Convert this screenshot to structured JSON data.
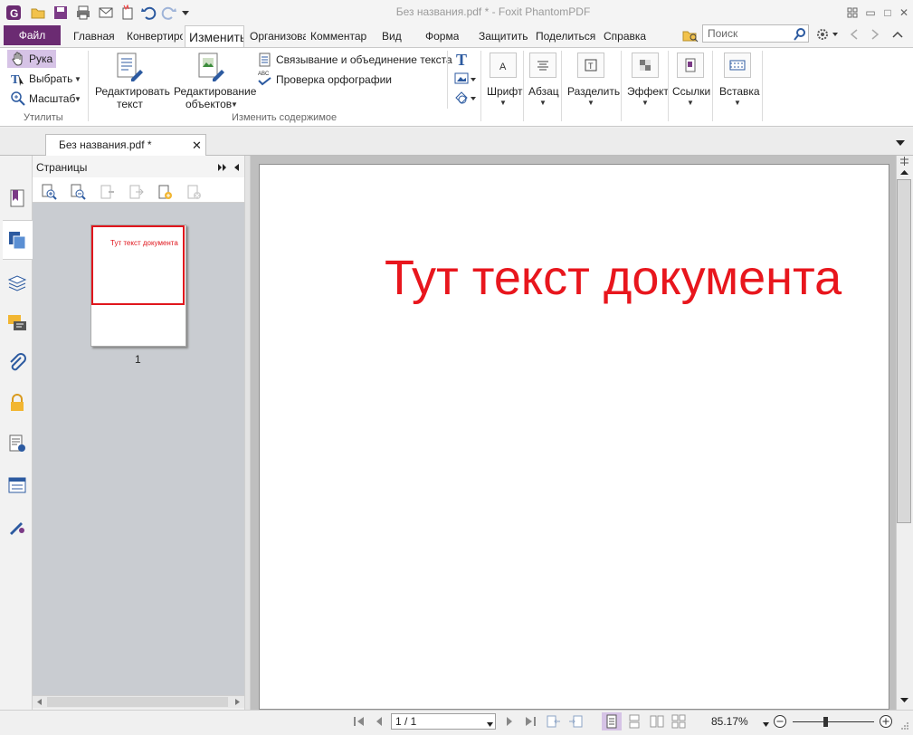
{
  "window": {
    "title": "Без названия.pdf * - Foxit PhantomPDF",
    "minimize": "▭",
    "maximize": "□",
    "close": "✕"
  },
  "ribbon_tabs": {
    "file": "Файл",
    "items": [
      "Главная",
      "Конвертиро",
      "Организова",
      "Комментар",
      "Вид",
      "Форма",
      "Защитить",
      "Поделиться",
      "Справка"
    ],
    "active": "Изменить"
  },
  "search": {
    "placeholder": "Поиск"
  },
  "ribbon": {
    "utilities": {
      "hand": "Рука",
      "select": "Выбрать",
      "zoom": "Масштаб",
      "group_label": "Утилиты"
    },
    "edit_content": {
      "edit_text_line1": "Редактировать",
      "edit_text_line2": "текст",
      "edit_objects_line1": "Редактирование",
      "edit_objects_line2": "объектов",
      "link_join": "Связывание и объединение текста",
      "spellcheck": "Проверка орфографии",
      "spellcheck_badge": "ABC",
      "group_label": "Изменить содержимое"
    },
    "groups": {
      "font": "Шрифт",
      "paragraph": "Абзац",
      "split": "Разделить",
      "effect": "Эффект",
      "links": "Ссылки",
      "insert": "Вставка"
    }
  },
  "document_tab": {
    "title": "Без названия.pdf *"
  },
  "pages_panel": {
    "title": "Страницы",
    "thumbnail_text": "Тут текст документа",
    "page_number": "1"
  },
  "document": {
    "text": "Тут текст документа",
    "text_color": "#e8161d"
  },
  "statusbar": {
    "page_value": "1 / 1",
    "zoom": "85.17%"
  },
  "colors": {
    "accent": "#6b2b72",
    "thumb_border": "#e0161d"
  }
}
